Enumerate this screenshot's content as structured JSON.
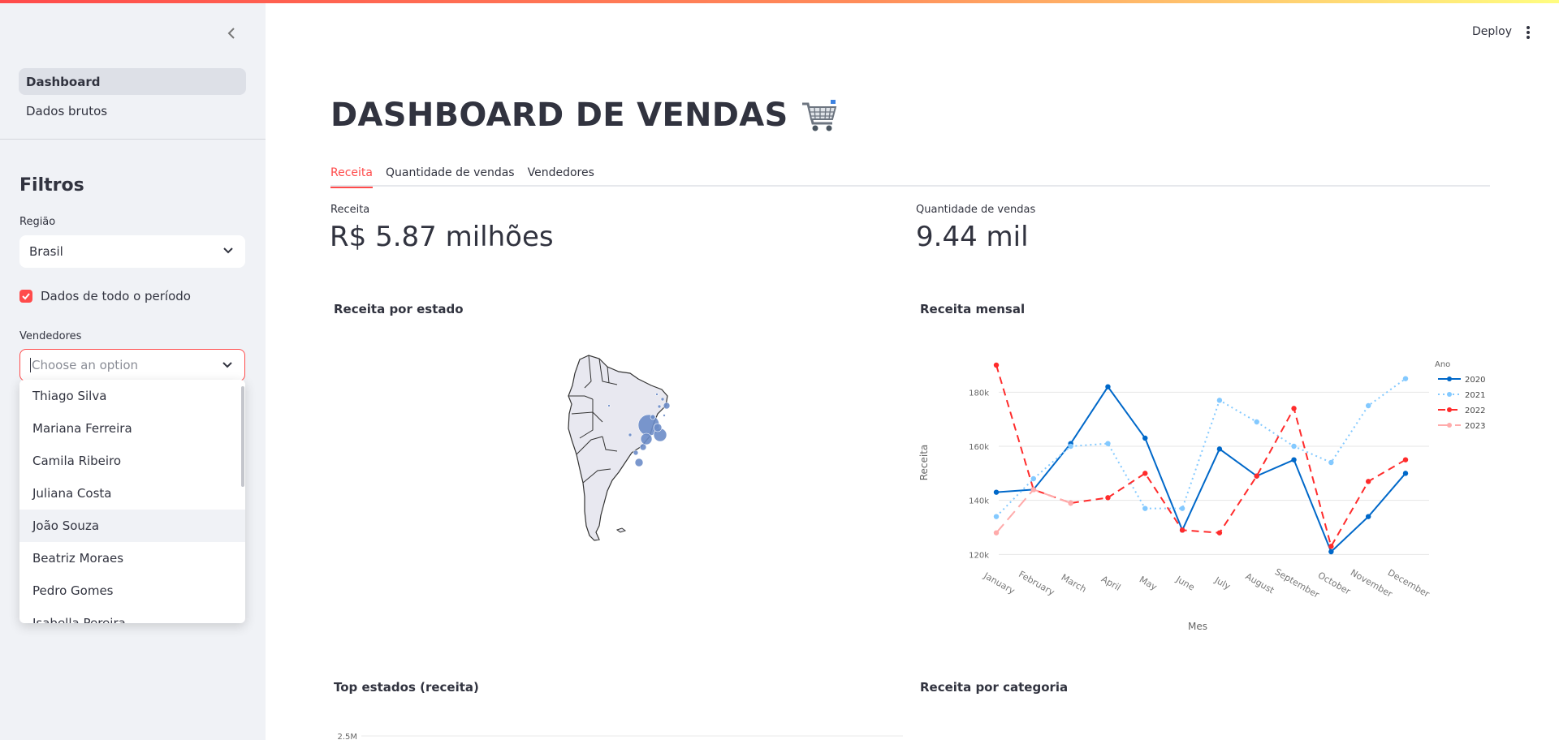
{
  "sidebar": {
    "nav": [
      {
        "label": "Dashboard",
        "active": true
      },
      {
        "label": "Dados brutos",
        "active": false
      }
    ],
    "filters_title": "Filtros",
    "regiao_label": "Região",
    "regiao_value": "Brasil",
    "periodo_label": "Dados de todo o período",
    "periodo_checked": true,
    "vendedores_label": "Vendedores",
    "vendedores_placeholder": "Choose an option",
    "vendedores_options": [
      "Thiago Silva",
      "Mariana Ferreira",
      "Camila Ribeiro",
      "Juliana Costa",
      "João Souza",
      "Beatriz Moraes",
      "Pedro Gomes",
      "Isabella Pereira"
    ],
    "hovered_option": "João Souza"
  },
  "header": {
    "deploy_label": "Deploy"
  },
  "main": {
    "title": "DASHBOARD DE VENDAS",
    "title_icon": "shopping-cart-icon",
    "tabs": [
      {
        "label": "Receita",
        "active": true
      },
      {
        "label": "Quantidade de vendas",
        "active": false
      },
      {
        "label": "Vendedores",
        "active": false
      }
    ],
    "metrics": [
      {
        "label": "Receita",
        "value": "R$ 5.87 milhões"
      },
      {
        "label": "Quantidade de vendas",
        "value": "9.44 mil"
      }
    ],
    "charts": {
      "map_title": "Receita por estado",
      "line_title": "Receita mensal",
      "bar_title": "Top estados (receita)",
      "category_title": "Receita por categoria",
      "bar_axis_top": "2.5M"
    }
  },
  "colors": {
    "accent": "#ff4b4b",
    "sidebar_bg": "#f0f2f6",
    "bubble": "#6b8cc8"
  },
  "chart_data": {
    "type": "line",
    "title": "Receita mensal",
    "xlabel": "Mes",
    "ylabel": "Receita",
    "legend_title": "Ano",
    "legend_position": "right",
    "ylim": [
      112000,
      190000
    ],
    "yticks": [
      120000,
      140000,
      160000,
      180000
    ],
    "ytick_labels": [
      "120k",
      "140k",
      "160k",
      "180k"
    ],
    "categories": [
      "January",
      "February",
      "March",
      "April",
      "May",
      "June",
      "July",
      "August",
      "September",
      "October",
      "November",
      "December"
    ],
    "series": [
      {
        "name": "2020",
        "color": "#0068c9",
        "dash": "solid",
        "values": [
          143000,
          144000,
          161000,
          182000,
          163000,
          129000,
          159000,
          149000,
          155000,
          121000,
          134000,
          150000
        ]
      },
      {
        "name": "2021",
        "color": "#83c9ff",
        "dash": "dot",
        "values": [
          134000,
          148000,
          160000,
          161000,
          137000,
          137000,
          177000,
          169000,
          160000,
          154000,
          175000,
          185000
        ]
      },
      {
        "name": "2022",
        "color": "#ff2b2b",
        "dash": "dash",
        "values": [
          190000,
          144000,
          139000,
          141000,
          150000,
          129000,
          128000,
          149000,
          174000,
          123000,
          147000,
          155000
        ]
      },
      {
        "name": "2023",
        "color": "#ffabab",
        "dash": "longdash",
        "values": [
          128000,
          144000,
          139000,
          null,
          null,
          null,
          null,
          null,
          null,
          null,
          null,
          null
        ]
      }
    ]
  }
}
